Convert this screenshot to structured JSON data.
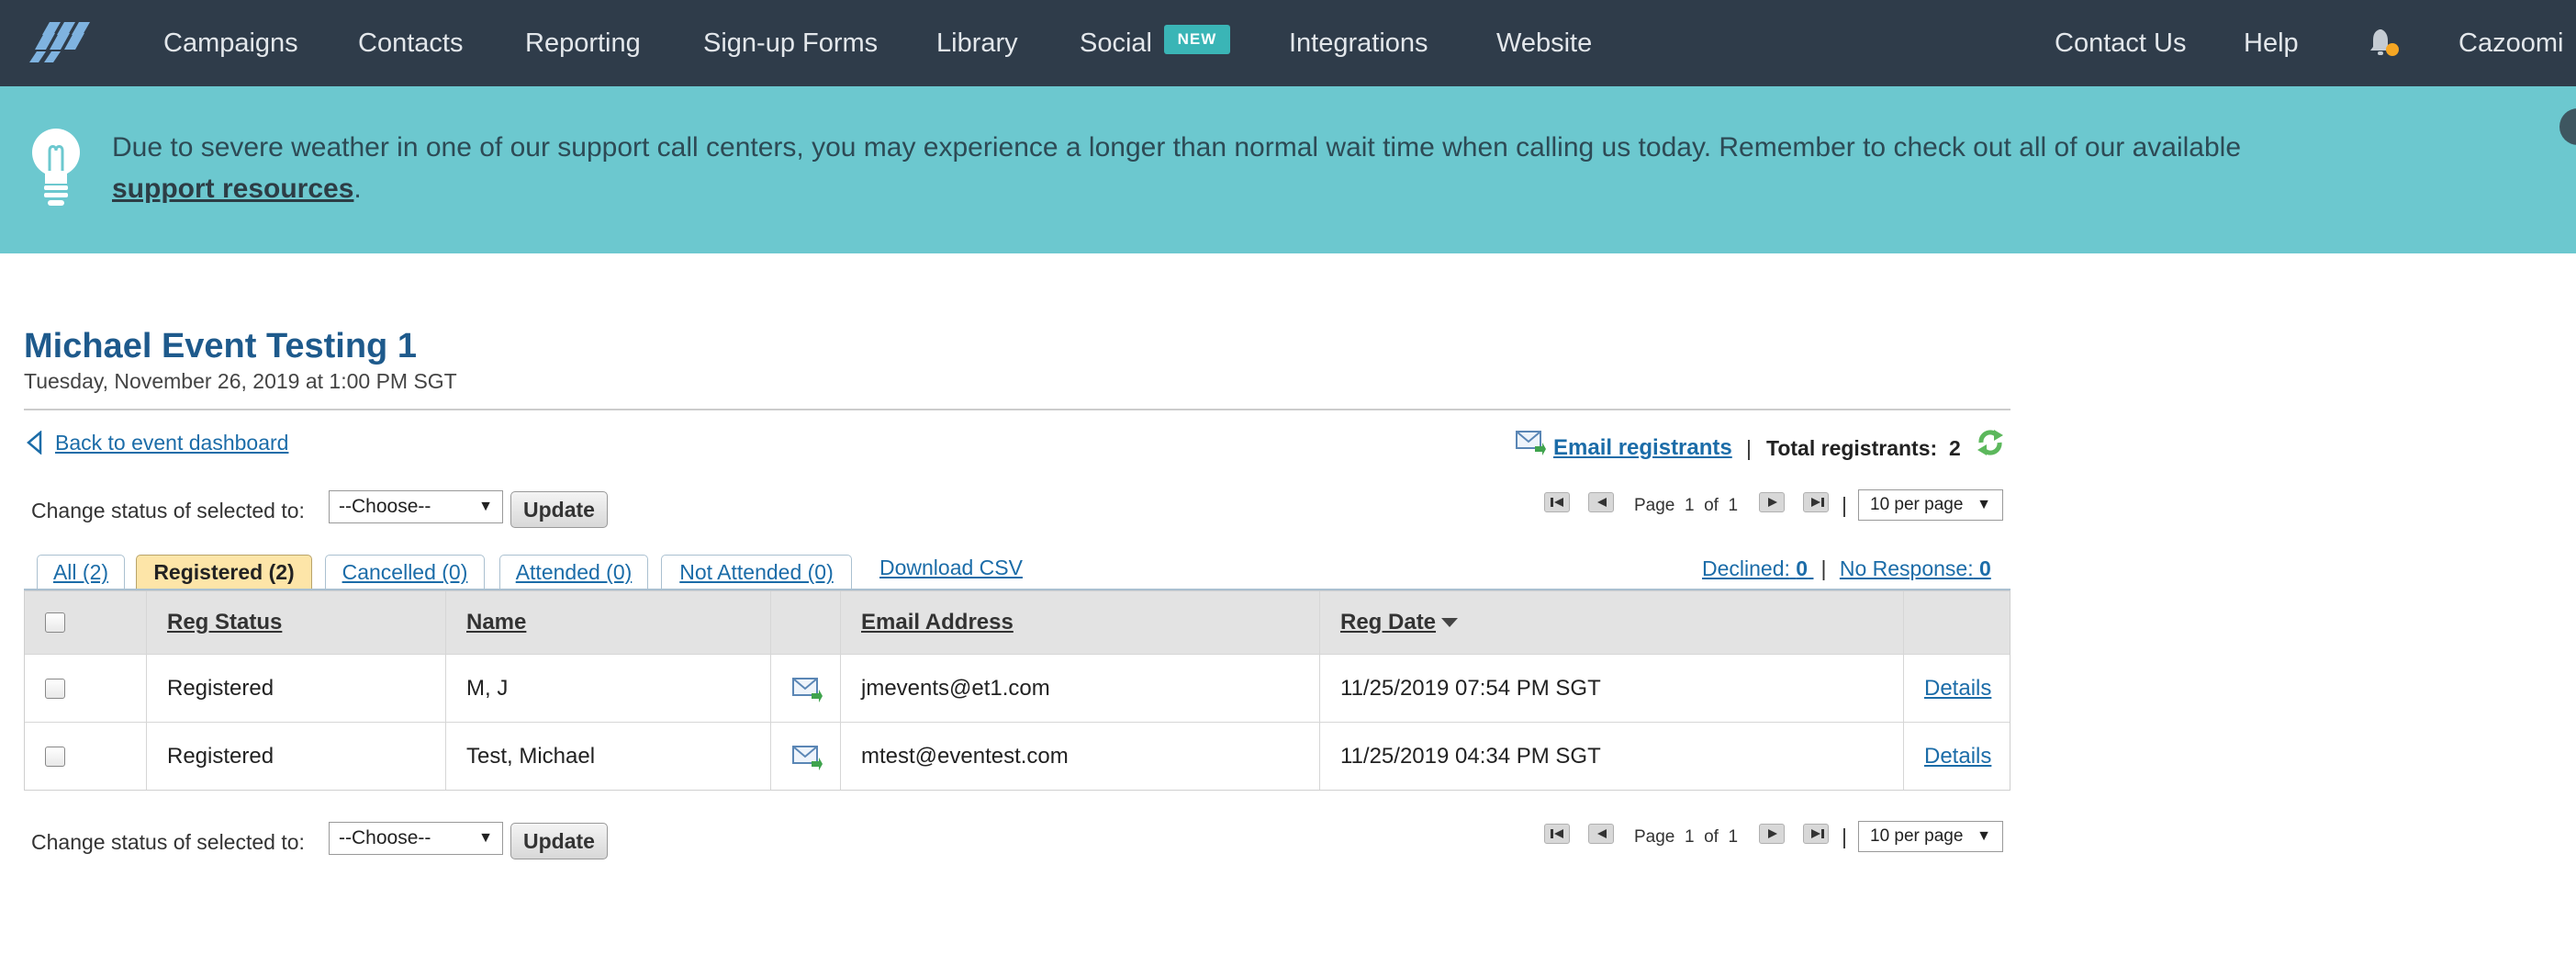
{
  "topnav": {
    "items": [
      "Campaigns",
      "Contacts",
      "Reporting",
      "Sign-up Forms",
      "Library",
      "Social",
      "Integrations",
      "Website"
    ],
    "new_badge": "NEW",
    "right_items": [
      "Contact Us",
      "Help"
    ],
    "account": "Cazoomi",
    "icons": [
      "logo",
      "bell-icon"
    ],
    "colors": {
      "background": "#2f3c4a",
      "badge": "#3ab5b6",
      "notification_dot": "#f5a623"
    }
  },
  "banner": {
    "text": "Due to severe weather in one of our support call centers, you may experience a longer than normal wait time when calling us today. Remember to check out all of our available",
    "link": "support resources",
    "suffix": ".",
    "icons": [
      "lightbulb-icon",
      "close-icon"
    ],
    "background": "#6cc8cf"
  },
  "event": {
    "title": "Michael Event Testing 1",
    "datetime": "Tuesday, November 26, 2019 at 1:00 PM SGT"
  },
  "actions": {
    "back": "Back to event dashboard",
    "email_registrants": "Email registrants",
    "separator": "|",
    "total_label": "Total registrants:",
    "total_value": "2"
  },
  "status_controls": {
    "label": "Change status of selected to:",
    "select_value": "--Choose--",
    "update_button": "Update"
  },
  "pager": {
    "page_label": "Page",
    "current": "1",
    "of_label": "of",
    "total": "1",
    "separator": "|",
    "per_page": "10 per page"
  },
  "tabs": [
    {
      "label": "All (2)",
      "active": false
    },
    {
      "label": "Registered (2)",
      "active": true
    },
    {
      "label": "Cancelled (0)",
      "active": false
    },
    {
      "label": "Attended (0)",
      "active": false
    },
    {
      "label": "Not Attended (0)",
      "active": false
    }
  ],
  "download_csv": "Download CSV",
  "counts": {
    "declined_label": "Declined:",
    "declined_value": "0",
    "separator": "|",
    "no_response_label": "No Response:",
    "no_response_value": "0"
  },
  "table": {
    "headers": [
      "Reg Status",
      "Name",
      "Email Address",
      "Reg Date"
    ],
    "rows": [
      {
        "status": "Registered",
        "name": "M, J",
        "email": "jmevents@et1.com",
        "date": "11/25/2019 07:54 PM SGT",
        "action": "Details"
      },
      {
        "status": "Registered",
        "name": "Test, Michael",
        "email": "mtest@eventest.com",
        "date": "11/25/2019 04:34 PM SGT",
        "action": "Details"
      }
    ]
  }
}
